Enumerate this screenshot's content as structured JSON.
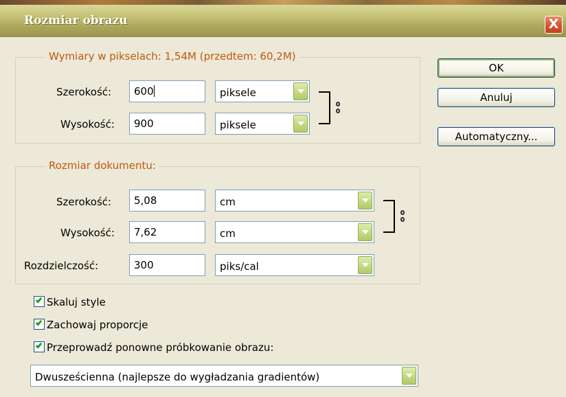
{
  "window": {
    "title": "Rozmiar obrazu",
    "close_glyph": "X"
  },
  "pixel_dimensions": {
    "legend": "Wymiary w pikselach:  1,54M (przedtem: 60,2M)",
    "width_label": "Szerokość:",
    "width_value": "600",
    "width_unit": "piksele",
    "height_label": "Wysokość:",
    "height_value": "900",
    "height_unit": "piksele"
  },
  "document_size": {
    "legend": "Rozmiar dokumentu:",
    "width_label": "Szerokość:",
    "width_value": "5,08",
    "width_unit": "cm",
    "height_label": "Wysokość:",
    "height_value": "7,62",
    "height_unit": "cm",
    "resolution_label": "Rozdzielczość:",
    "resolution_value": "300",
    "resolution_unit": "piks/cal"
  },
  "buttons": {
    "ok": "OK",
    "cancel": "Anuluj",
    "auto": "Automatyczny..."
  },
  "options": {
    "scale_styles": {
      "label": "Skaluj style",
      "checked": true
    },
    "constrain": {
      "label": "Zachowaj proporcje",
      "checked": true
    },
    "resample": {
      "label": "Przeprowadź ponowne próbkowanie obrazu:",
      "checked": true
    }
  },
  "resample_method": {
    "value": "Dwusześcienna (najlepsze do wygładzania gradientów)"
  },
  "colors": {
    "legend": "#c0580e",
    "background": "#ECE9D8",
    "close_red": "#d2512e",
    "dropdown_green": "#c6db83"
  }
}
